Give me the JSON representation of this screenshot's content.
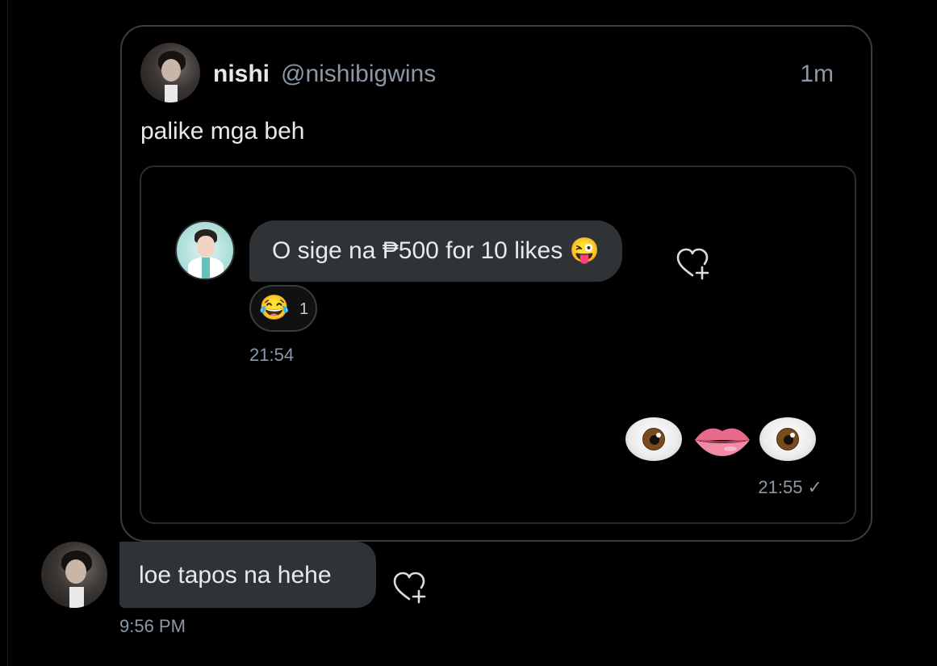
{
  "quoted_tweet": {
    "display_name": "nishi",
    "handle": "@nishibigwins",
    "time_ago": "1m",
    "text": "palike mga beh",
    "avatar_icon": "user-avatar",
    "media": {
      "incoming_message": {
        "text": "O sige na ₱500 for 10 likes 😜",
        "avatar_icon": "doctor-avatar",
        "reaction_emoji": "😂",
        "reaction_count": "1",
        "time": "21:54",
        "react_icon": "heart-plus-icon"
      },
      "outgoing_message": {
        "emojis": [
          "eye",
          "lips",
          "eye"
        ],
        "time": "21:55 ✓"
      }
    }
  },
  "message": {
    "text": "loe tapos na hehe",
    "time": "9:56 PM",
    "avatar_icon": "user-avatar",
    "react_icon": "heart-plus-icon"
  },
  "colors": {
    "background": "#000000",
    "bubble": "#2f3336",
    "border": "#3a3d40",
    "muted_text": "#8b98a5",
    "primary_text": "#e7e9ea"
  }
}
